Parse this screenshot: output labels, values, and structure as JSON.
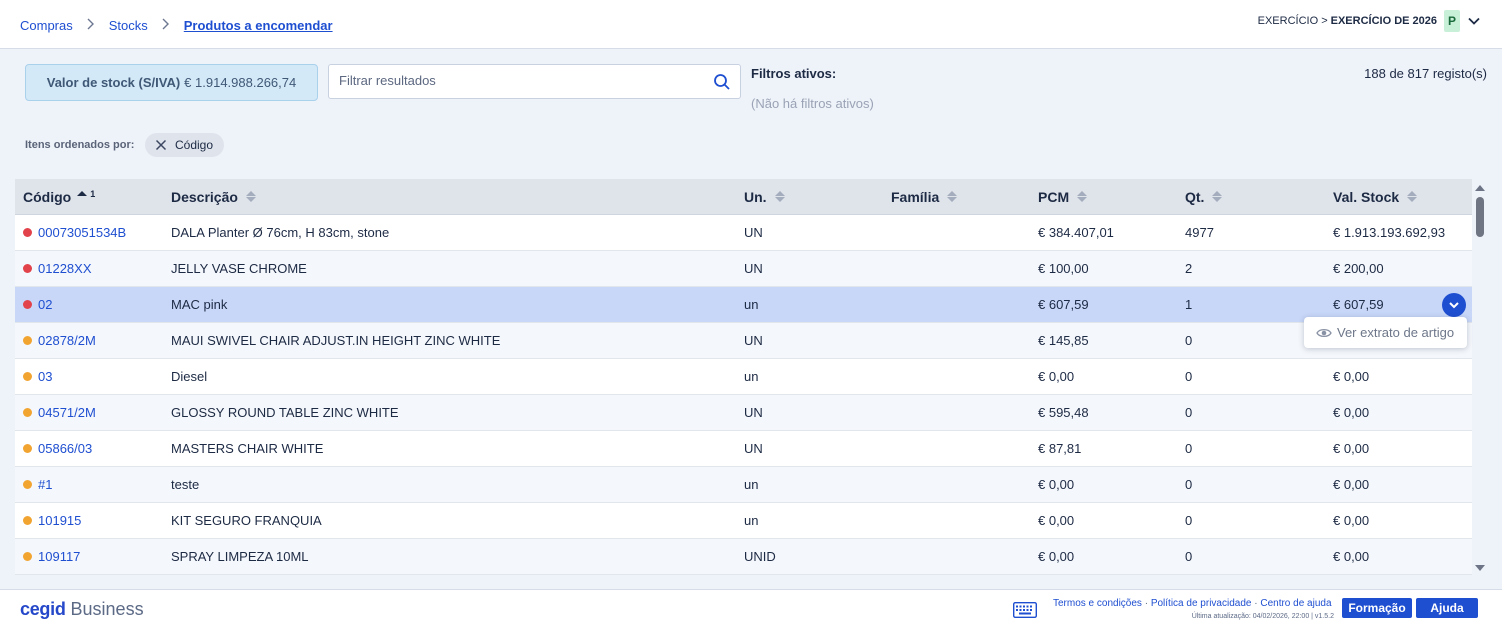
{
  "breadcrumb": {
    "items": [
      "Compras",
      "Stocks"
    ],
    "current": "Produtos a encomendar"
  },
  "exercise": {
    "prefix": "EXERCÍCIO >",
    "value": "EXERCÍCIO DE 2026",
    "badge": "P"
  },
  "stock_value": {
    "label": "Valor de stock (S/IVA)",
    "value": "€ 1.914.988.266,74"
  },
  "search": {
    "placeholder": "Filtrar resultados",
    "value": ""
  },
  "filters": {
    "title": "Filtros ativos:",
    "none": "(Não há filtros ativos)"
  },
  "records": "188 de 817 registo(s)",
  "ordering": {
    "label": "Itens ordenados por:",
    "chip": "Código"
  },
  "table": {
    "columns": [
      "Código",
      "Descrição",
      "Un.",
      "Família",
      "PCM",
      "Qt.",
      "Val. Stock"
    ],
    "sort_index": "1",
    "rows": [
      {
        "status": "red",
        "code": "00073051534B",
        "desc": "DALA Planter Ø 76cm, H 83cm, stone",
        "un": "UN",
        "familia": "",
        "pcm": "€ 384.407,01",
        "qt": "4977",
        "val": "€ 1.913.193.692,93"
      },
      {
        "status": "red",
        "code": "01228XX",
        "desc": "JELLY VASE CHROME",
        "un": "UN",
        "familia": "",
        "pcm": "€ 100,00",
        "qt": "2",
        "val": "€ 200,00"
      },
      {
        "status": "red",
        "code": "02",
        "desc": "MAC pink",
        "un": "un",
        "familia": "",
        "pcm": "€ 607,59",
        "qt": "1",
        "val": "€ 607,59"
      },
      {
        "status": "orange",
        "code": "02878/2M",
        "desc": "MAUI SWIVEL CHAIR ADJUST.IN HEIGHT ZINC WHITE",
        "un": "UN",
        "familia": "",
        "pcm": "€ 145,85",
        "qt": "0",
        "val": ""
      },
      {
        "status": "orange",
        "code": "03",
        "desc": "Diesel",
        "un": "un",
        "familia": "",
        "pcm": "€ 0,00",
        "qt": "0",
        "val": "€ 0,00"
      },
      {
        "status": "orange",
        "code": "04571/2M",
        "desc": "GLOSSY ROUND TABLE ZINC WHITE",
        "un": "UN",
        "familia": "",
        "pcm": "€ 595,48",
        "qt": "0",
        "val": "€ 0,00"
      },
      {
        "status": "orange",
        "code": "05866/03",
        "desc": "MASTERS CHAIR WHITE",
        "un": "UN",
        "familia": "",
        "pcm": "€ 87,81",
        "qt": "0",
        "val": "€ 0,00"
      },
      {
        "status": "orange",
        "code": "#1",
        "desc": "teste",
        "un": "un",
        "familia": "",
        "pcm": "€ 0,00",
        "qt": "0",
        "val": "€ 0,00"
      },
      {
        "status": "orange",
        "code": "101915",
        "desc": "KIT SEGURO FRANQUIA",
        "un": "un",
        "familia": "",
        "pcm": "€ 0,00",
        "qt": "0",
        "val": "€ 0,00"
      },
      {
        "status": "orange",
        "code": "109117",
        "desc": "SPRAY LIMPEZA 10ML",
        "un": "UNID",
        "familia": "",
        "pcm": "€ 0,00",
        "qt": "0",
        "val": "€ 0,00"
      }
    ],
    "selected_row": 2
  },
  "row_menu": {
    "item": "Ver extrato de artigo"
  },
  "status_colors": {
    "red": "#e2434b",
    "orange": "#f2a431"
  },
  "footer": {
    "logo_brand": "cegid",
    "logo_product": "Business",
    "links": [
      "Termos e condições",
      "Política de privacidade",
      "Centro de ajuda"
    ],
    "updated": "Última atualização: 04/02/2026, 22:00 | v1.5.2",
    "btn_training": "Formação",
    "btn_help": "Ajuda"
  }
}
